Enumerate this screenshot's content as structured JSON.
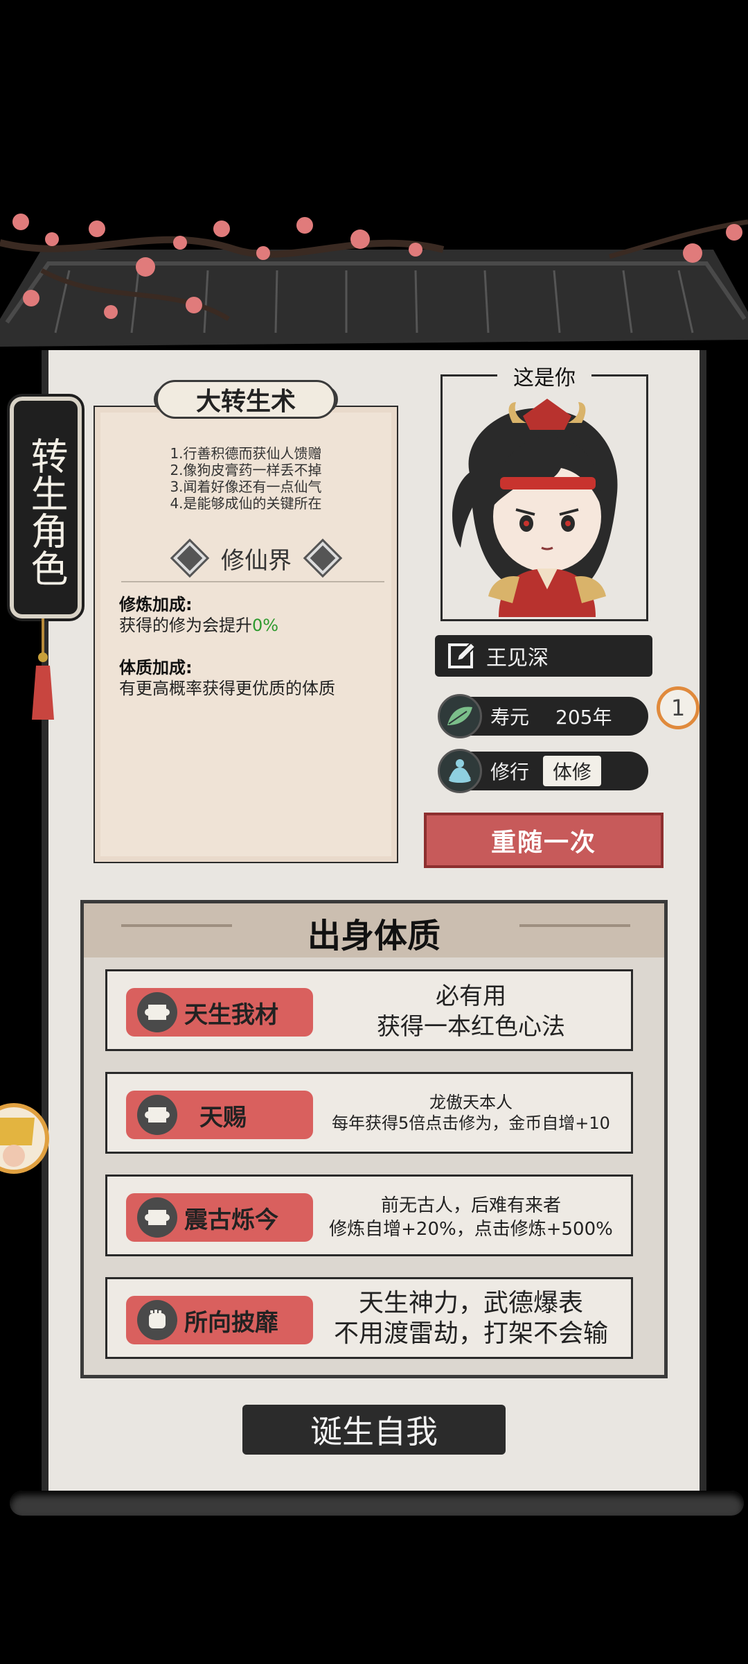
{
  "side_banner": {
    "label": "转生角色"
  },
  "rebirth_scroll": {
    "title": "大转生术",
    "tips": [
      "1.行善积德而获仙人馈赠",
      "2.像狗皮膏药一样丢不掉",
      "3.闻着好像还有一点仙气",
      "4.是能够成仙的关键所在"
    ],
    "realm": "修仙界",
    "bonus1_title": "修炼加成:",
    "bonus1_text": "获得的修为会提升",
    "bonus1_percent": "0%",
    "bonus2_title": "体质加成:",
    "bonus2_text": "有更高概率获得更优质的体质"
  },
  "character": {
    "portrait_tag": "这是你",
    "name": "王见深",
    "lifespan_label": "寿元",
    "lifespan_value": "205年",
    "cultivation_label": "修行",
    "cultivation_value": "体修",
    "counter": "1",
    "reroll_label": "重随一次"
  },
  "origin": {
    "title": "出身体质",
    "traits": [
      {
        "name": "天生我材",
        "line1": "必有用",
        "line2": "获得一本红色心法",
        "icon": "scroll-icon"
      },
      {
        "name": "天赐",
        "line1": "龙傲天本人",
        "line2": "每年获得5倍点击修为，金币自增+10",
        "icon": "scroll-icon"
      },
      {
        "name": "震古烁今",
        "line1": "前无古人，后难有来者",
        "line2": "修炼自增+20%，点击修炼+500%",
        "icon": "scroll-icon"
      },
      {
        "name": "所向披靡",
        "line1": "天生神力，武德爆表",
        "line2": "不用渡雷劫，打架不会输",
        "icon": "fist-icon"
      }
    ]
  },
  "born_button": {
    "label": "诞生自我"
  },
  "colors": {
    "accent_red": "#c75a5a",
    "dark_bar": "#242424",
    "panel_bg": "#e9e6e1",
    "percent_green": "#2f9a2f",
    "counter_ring": "#e08a3c"
  }
}
